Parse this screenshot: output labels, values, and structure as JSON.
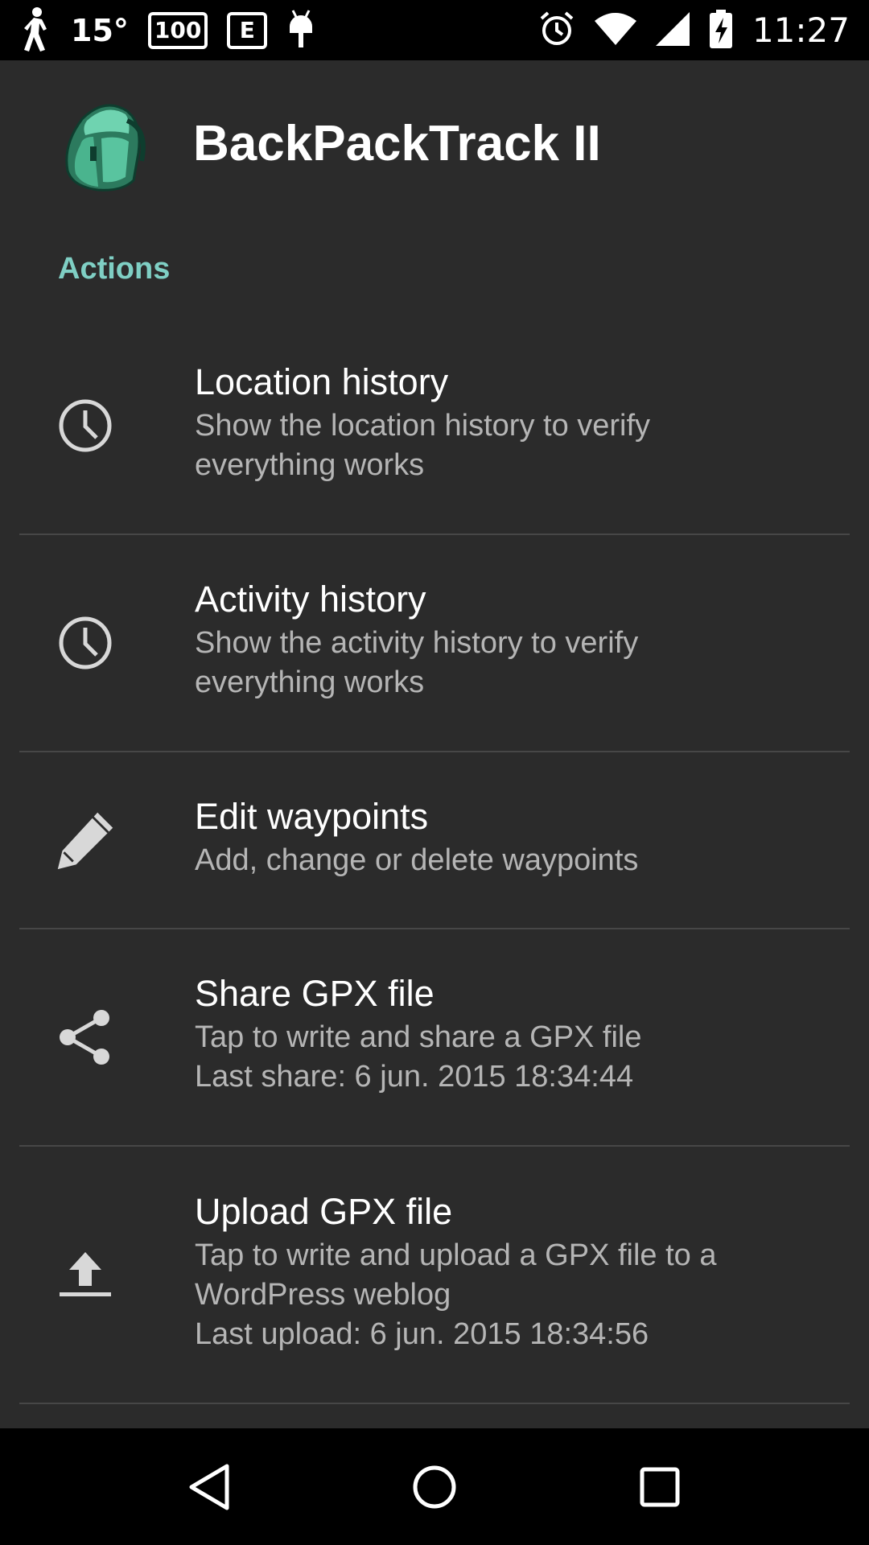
{
  "status_bar": {
    "temperature": "15°",
    "battery_label": "100",
    "mode_badge": "E",
    "time": "11:27"
  },
  "app": {
    "title": "BackPackTrack II",
    "accent_color": "#7fcfc4"
  },
  "section": {
    "title": "Actions"
  },
  "prefs": [
    {
      "icon": "clock-icon",
      "title": "Location history",
      "summary": "Show the location history to verify\neverything works"
    },
    {
      "icon": "clock-icon",
      "title": "Activity history",
      "summary": "Show the activity history to verify\neverything works"
    },
    {
      "icon": "pencil-icon",
      "title": "Edit waypoints",
      "summary": "Add, change or delete waypoints"
    },
    {
      "icon": "share-icon",
      "title": "Share GPX file",
      "summary": "Tap to write and share a GPX file\nLast share: 6 jun. 2015 18:34:44"
    },
    {
      "icon": "upload-icon",
      "title": "Upload GPX file",
      "summary": "Tap to write and upload a GPX file to a\nWordPress weblog\nLast upload: 6 jun. 2015 18:34:56"
    }
  ],
  "nav": {
    "back": "back-icon",
    "home": "home-icon",
    "recents": "recents-icon"
  }
}
